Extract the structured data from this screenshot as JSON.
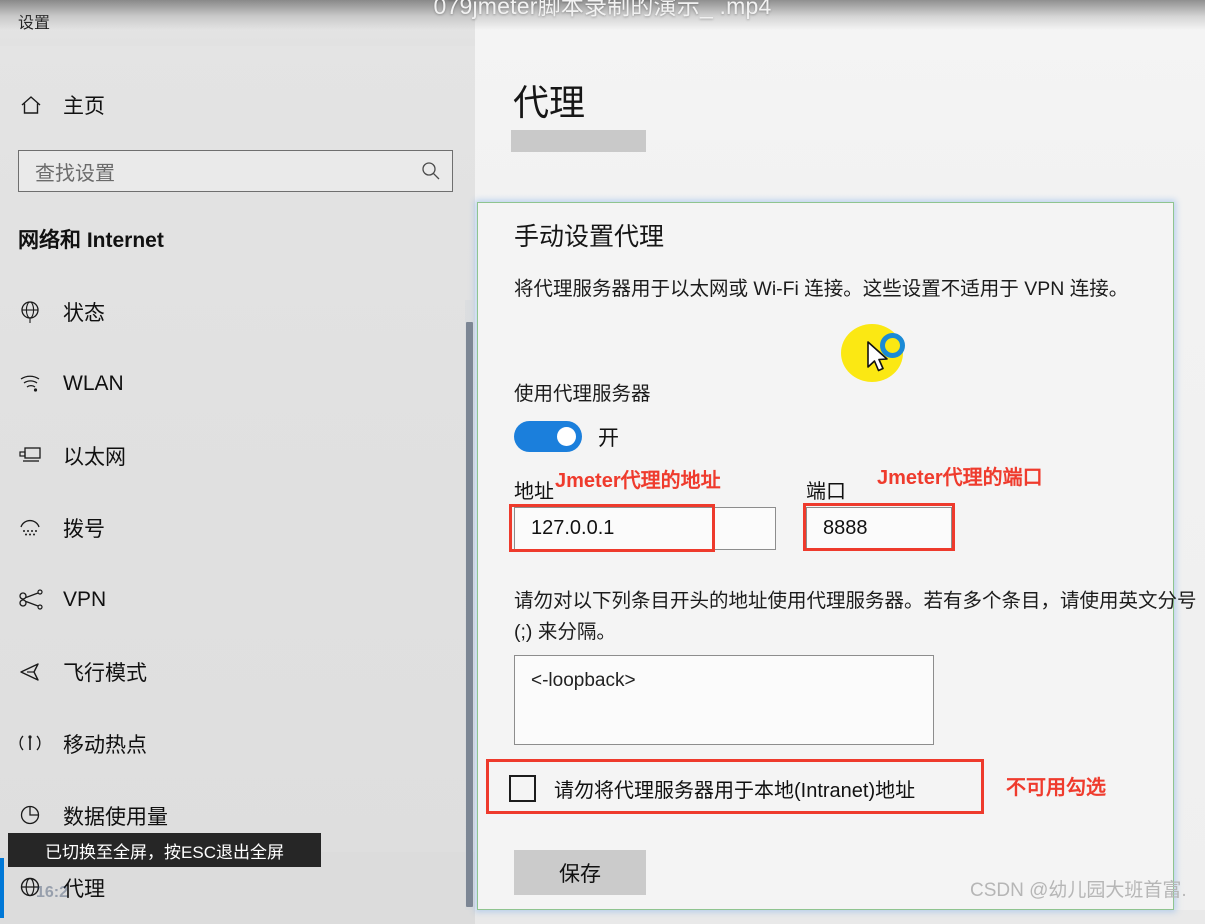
{
  "video": {
    "title": "079jmeter脚本录制的演示_ .mp4"
  },
  "settings_window": {
    "title": "设置",
    "home": {
      "label": "主页",
      "icon": "home-icon"
    },
    "search": {
      "placeholder": "查找设置",
      "value": "",
      "icon": "search-icon"
    },
    "category": "网络和 Internet",
    "nav_items": [
      {
        "label": "状态",
        "icon": "globe-icon",
        "selected": false
      },
      {
        "label": "WLAN",
        "icon": "wifi-icon",
        "selected": false
      },
      {
        "label": "以太网",
        "icon": "ethernet-icon",
        "selected": false
      },
      {
        "label": "拨号",
        "icon": "dialup-icon",
        "selected": false
      },
      {
        "label": "VPN",
        "icon": "vpn-icon",
        "selected": false
      },
      {
        "label": "飞行模式",
        "icon": "airplane-icon",
        "selected": false
      },
      {
        "label": "移动热点",
        "icon": "hotspot-icon",
        "selected": false
      },
      {
        "label": "数据使用量",
        "icon": "data-usage-icon",
        "selected": false
      },
      {
        "label": "代理",
        "icon": "proxy-globe-icon",
        "selected": true
      }
    ]
  },
  "toast": {
    "message": "已切换至全屏，按ESC退出全屏"
  },
  "clock_watermark": "16:2",
  "content": {
    "page_title": "代理",
    "card": {
      "heading": "手动设置代理",
      "description": "将代理服务器用于以太网或 Wi-Fi 连接。这些设置不适用于 VPN 连接。",
      "toggle_label": "使用代理服务器",
      "toggle_state": "开",
      "toggle_on": true,
      "address_label": "地址",
      "address_value": "127.0.0.1",
      "port_label": "端口",
      "port_value": "8888",
      "exceptions_description": "请勿对以下列条目开头的地址使用代理服务器。若有多个条目，请使用英文分号 (;) 来分隔。",
      "exceptions_value": "<-loopback>",
      "checkbox_label": "请勿将代理服务器用于本地(Intranet)地址",
      "checkbox_checked": false,
      "save_label": "保存"
    }
  },
  "annotations": {
    "address": "Jmeter代理的地址",
    "port": "Jmeter代理的端口",
    "checkbox": "不可用勾选",
    "color": "#ee3a2c"
  },
  "watermark": {
    "csdn": "CSDN @幼儿园大班首富."
  }
}
